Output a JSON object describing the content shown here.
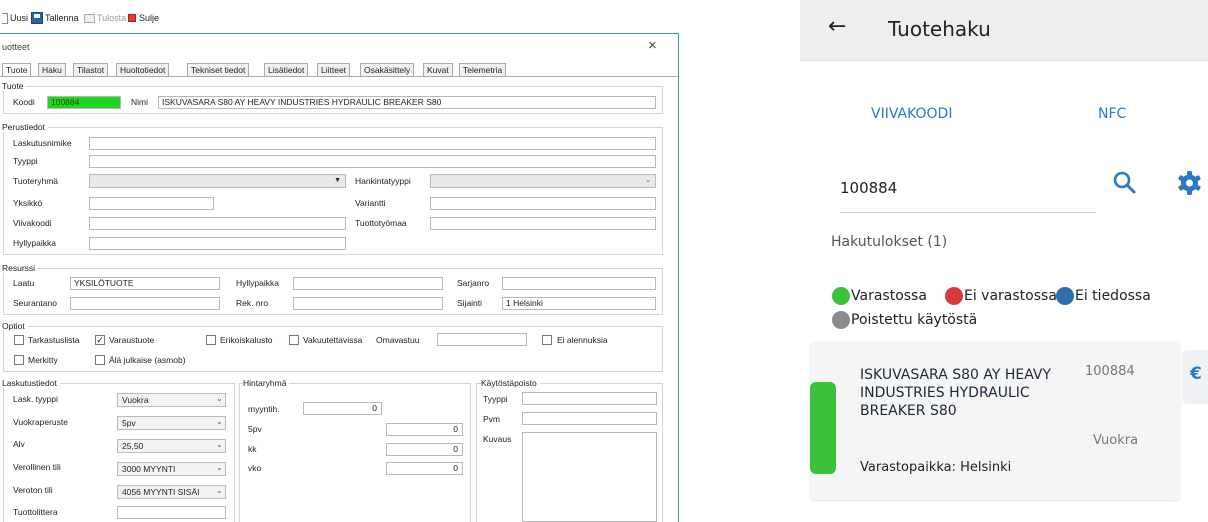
{
  "toolbar": {
    "new_label": "Uusi",
    "save_label": "Tallenna",
    "print_label": "Tulosta",
    "close_label": "Sulje"
  },
  "window": {
    "title": "uotteet",
    "close_symbol": "×"
  },
  "tabs": [
    "Tuote",
    "Haku",
    "Tilastot",
    "Huoltotiedot",
    "Tekniset tiedot",
    "Lisätiedot",
    "Liitteet",
    "Osakäsittely",
    "Kuvat",
    "Telemetria"
  ],
  "tuote": {
    "group": "Tuote",
    "koodi_label": "Koodi",
    "koodi_value": "100884",
    "nimi_label": "Nimi",
    "nimi_value": "ISKUVASARA S80 AY HEAVY INDUSTRIES HYDRAULIC BREAKER S80"
  },
  "perustiedot": {
    "group": "Perustiedot",
    "laskutusnimike": "Laskutusnimike",
    "tyyppi": "Tyyppi",
    "tuoteryhma": "Tuoteryhmä",
    "hankintatyyppi": "Hankintatyyppi",
    "yksikko": "Yksikkö",
    "variantti": "Variantti",
    "viivakoodi": "Viivakoodi",
    "tuottotyomaa": "Tuottotyömaa",
    "hyllypaikka": "Hyllypaikka"
  },
  "resurssi": {
    "group": "Resurssi",
    "laatu_label": "Laatu",
    "laatu_value": "YKSILÖTUOTE",
    "hyllypaikka_label": "Hyllypaikka",
    "sarjanro_label": "Sarjanro",
    "seurantano_label": "Seurantano",
    "reknro_label": "Rek. nro",
    "sijainti_label": "Sijainti",
    "sijainti_value": "1 Helsinki"
  },
  "optiot": {
    "group": "Optiot",
    "tarkastuslista": "Tarkastuslista",
    "varaustuote": "Varaustuote",
    "erikoiskalusto": "Erikoiskalusto",
    "vakuutettavissa": "Vakuutettavissa",
    "omavastuu": "Omavastuu",
    "ei_alennuksia": "Ei alennuksia",
    "merkitty": "Merkitty",
    "ala_julkaise": "Älä julkaise (asmob)",
    "check_mark": "✓"
  },
  "laskutustiedot": {
    "group": "Laskutustiedot",
    "lask_tyyppi_label": "Lask. tyyppi",
    "lask_tyyppi_value": "Vuokra",
    "vuokraperuste_label": "Vuokraperuste",
    "vuokraperuste_value": "5pv",
    "alv_label": "Alv",
    "alv_value": "25,50",
    "verollinen_label": "Verollinen tili",
    "verollinen_value": "3000 MYYNTI",
    "veroton_label": "Veroton tili",
    "veroton_value": "4056 MYYNTI SISÄI",
    "tuottolittera_label": "Tuottolittera"
  },
  "hintaryhma": {
    "group": "Hintaryhmä",
    "myyntih_label": "myyntih.",
    "myyntih_value": "0",
    "pv5_label": "5pv",
    "pv5_value": "0",
    "kk_label": "kk",
    "kk_value": "0",
    "vko_label": "vko",
    "vko_value": "0"
  },
  "kaytostapoisto": {
    "group": "Käytöstäpoisto",
    "tyyppi_label": "Tyyppi",
    "pvm_label": "Pvm",
    "kuvaus_label": "Kuvaus"
  },
  "mobile": {
    "title": "Tuotehaku",
    "back_symbol": "←",
    "tab_barcode": "VIIVAKOODI",
    "tab_nfc": "NFC",
    "search_value": "100884",
    "results_label": "Hakutulokset (1)",
    "legend": [
      {
        "label": "Varastossa",
        "color": "#3cc13c"
      },
      {
        "label": "Ei varastossa",
        "color": "#d23c3c"
      },
      {
        "label": "Ei tiedossa",
        "color": "#2f6fb0"
      },
      {
        "label": "Poistettu käytöstä",
        "color": "#8c8c8c"
      }
    ],
    "result": {
      "name": "ISKUVASARA S80 AY HEAVY INDUSTRIES HYDRAULIC BREAKER S80",
      "code": "100884",
      "type": "Vuokra",
      "location": "Varastopaikka: Helsinki",
      "currency_symbol": "€",
      "status_color": "#3cc13c"
    },
    "colors": {
      "accent": "#2a78c6",
      "header_bg": "#eeeeee"
    }
  }
}
